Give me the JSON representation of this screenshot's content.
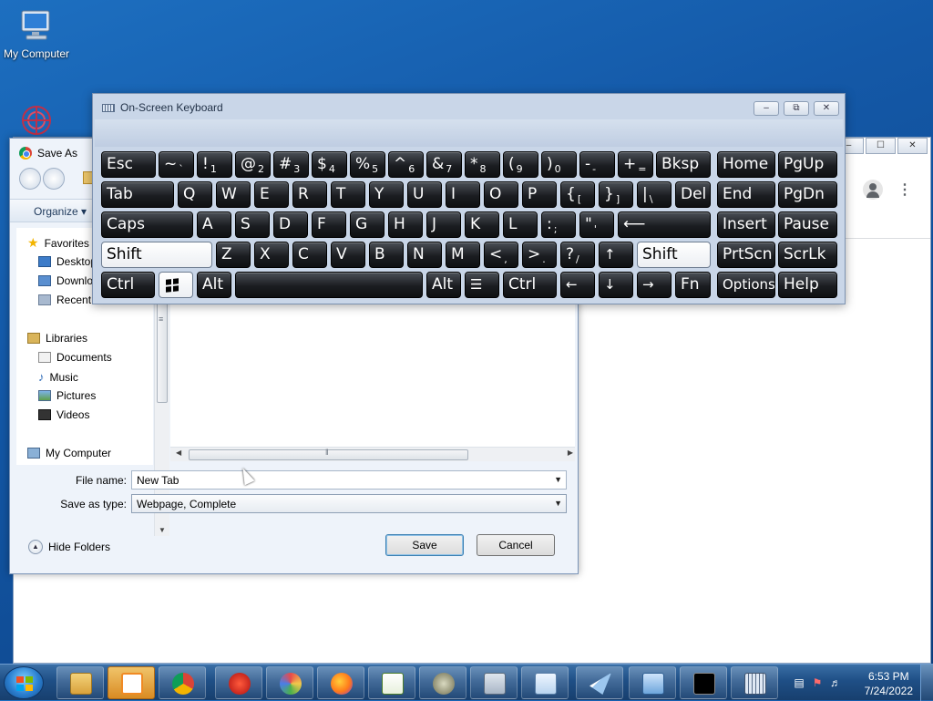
{
  "desktop": {
    "icons": [
      {
        "label": "My Computer"
      },
      {
        "label": ""
      }
    ]
  },
  "chrome_window": {
    "caption_buttons": [
      "–",
      "☐",
      "✕"
    ]
  },
  "save_dialog": {
    "title": "Save As",
    "toolbar": {
      "organize": "Organize"
    },
    "nav": {
      "favorites": "Favorites",
      "desktop": "Desktop",
      "downloads": "Downloads",
      "recent": "Recent",
      "libraries": "Libraries",
      "documents": "Documents",
      "music": "Music",
      "pictures": "Pictures",
      "videos": "Videos",
      "computer": "My Computer"
    },
    "file_name_label": "File name:",
    "file_name_value": "New Tab",
    "save_type_label": "Save as type:",
    "save_type_value": "Webpage, Complete",
    "hide_folders": "Hide Folders",
    "save_button": "Save",
    "cancel_button": "Cancel"
  },
  "osk": {
    "title": "On-Screen Keyboard",
    "caption_buttons": [
      "–",
      "⧉",
      "✕"
    ],
    "keys": {
      "esc": "Esc",
      "tilde": "~",
      "tilde_sub": "`",
      "k1": "!",
      "k1_sub": "1",
      "k2": "@",
      "k2_sub": "2",
      "k3": "#",
      "k3_sub": "3",
      "k4": "$",
      "k4_sub": "4",
      "k5": "%",
      "k5_sub": "5",
      "k6": "^",
      "k6_sub": "6",
      "k7": "&",
      "k7_sub": "7",
      "k8": "*",
      "k8_sub": "8",
      "k9": "(",
      "k9_sub": "9",
      "k0": ")",
      "k0_sub": "0",
      "minus": "-",
      "minus_sub": "-",
      "plus": "+",
      "plus_sub": "=",
      "bksp": "Bksp",
      "home": "Home",
      "pgup": "PgUp",
      "tab": "Tab",
      "q": "Q",
      "w": "W",
      "e": "E",
      "r": "R",
      "t": "T",
      "y": "Y",
      "u": "U",
      "i": "I",
      "o": "O",
      "p": "P",
      "lbrace": "{",
      "lbrace_sub": "[",
      "rbrace": "}",
      "rbrace_sub": "]",
      "pipe": "|",
      "pipe_sub": "\\",
      "del": "Del",
      "end": "End",
      "pgdn": "PgDn",
      "caps": "Caps",
      "a": "A",
      "s": "S",
      "d": "D",
      "f": "F",
      "g": "G",
      "h": "H",
      "j": "J",
      "k": "K",
      "l": "L",
      "colon": ":",
      "colon_sub": ";",
      "quote": "\"",
      "quote_sub": "'",
      "enter": "⟵",
      "insert": "Insert",
      "pause": "Pause",
      "shift_l": "Shift",
      "z": "Z",
      "x": "X",
      "c": "C",
      "v": "V",
      "b": "B",
      "n": "N",
      "m": "M",
      "lt": "<",
      "lt_sub": ",",
      "gt": ">",
      "gt_sub": ".",
      "qm": "?",
      "qm_sub": "/",
      "up": "↑",
      "shift_r": "Shift",
      "prtscn": "PrtScn",
      "scrlk": "ScrLk",
      "ctrl_l": "Ctrl",
      "alt_l": "Alt",
      "space": "",
      "alt_r": "Alt",
      "menu": "☰",
      "ctrl_r": "Ctrl",
      "left": "←",
      "down": "↓",
      "right": "→",
      "fn": "Fn",
      "options": "Options",
      "help": "Help"
    }
  },
  "taskbar": {
    "clock_time": "6:53 PM",
    "clock_date": "7/24/2022"
  },
  "colors": {
    "desktop_bg": "#1459a8",
    "key_dark": "#1b1d21",
    "key_white": "#ffffff"
  }
}
